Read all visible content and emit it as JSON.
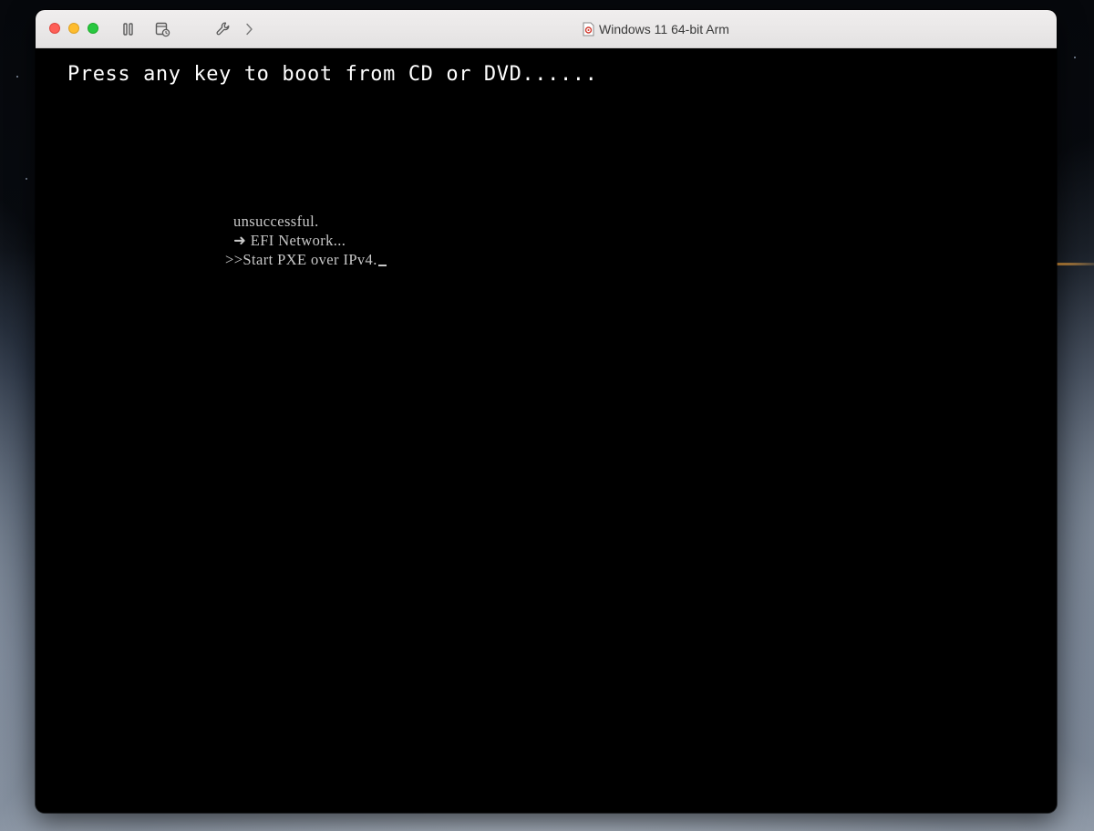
{
  "window": {
    "title": "Windows 11 64-bit Arm"
  },
  "toolbar": {
    "icons": [
      "pause-icon",
      "snapshot-icon",
      "settings-wrench-icon",
      "chevron-right-icon"
    ]
  },
  "screen": {
    "boot_prompt": "Press any key to boot from CD or DVD......",
    "efi_lines": [
      "unsuccessful.",
      "➜ EFI Network...",
      ">>Start PXE over IPv4."
    ]
  },
  "colors": {
    "close": "#fe5f57",
    "minimize": "#febc2e",
    "zoom": "#28c840",
    "screen_background": "#000000",
    "console_text": "#c8c8c8"
  }
}
